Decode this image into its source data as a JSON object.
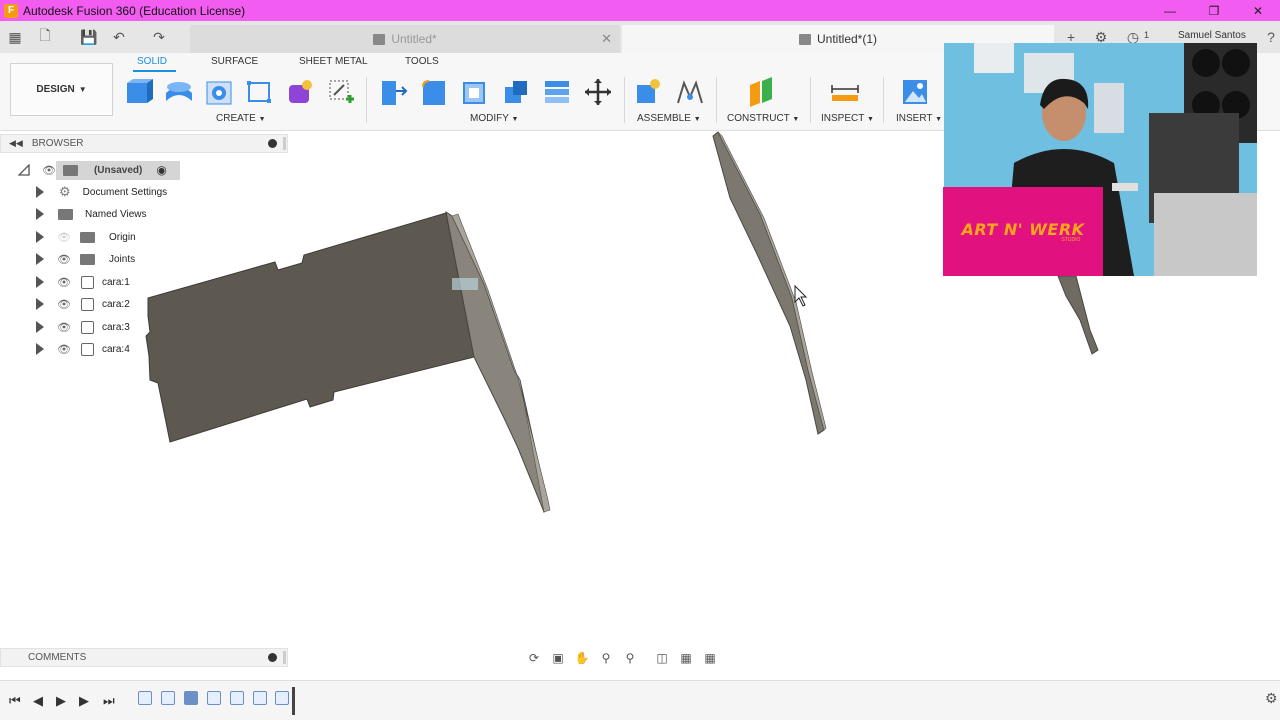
{
  "window": {
    "title": "Autodesk Fusion 360 (Education License)",
    "app_logo": "F"
  },
  "tabs": [
    {
      "label": "Untitled*",
      "active": false
    },
    {
      "label": "Untitled*(1)",
      "active": true
    }
  ],
  "user": {
    "name": "Samuel Santos"
  },
  "notifications_count": "1",
  "toolbar": {
    "workspace": "DESIGN",
    "workspace_tabs": [
      "SOLID",
      "SURFACE",
      "SHEET METAL",
      "TOOLS"
    ],
    "active_tab": "SOLID",
    "groups": [
      "CREATE",
      "MODIFY",
      "ASSEMBLE",
      "CONSTRUCT",
      "INSPECT",
      "INSERT"
    ]
  },
  "browser": {
    "title": "BROWSER",
    "root": "(Unsaved)",
    "items": [
      {
        "label": "Document Settings",
        "icon": "gear-icon"
      },
      {
        "label": "Named Views",
        "icon": "folder-icon"
      },
      {
        "label": "Origin",
        "icon": "folder-icon"
      },
      {
        "label": "Joints",
        "icon": "folder-icon"
      },
      {
        "label": "cara:1",
        "icon": "component-icon"
      },
      {
        "label": "cara:2",
        "icon": "component-icon"
      },
      {
        "label": "cara:3",
        "icon": "component-icon"
      },
      {
        "label": "cara:4",
        "icon": "component-icon"
      }
    ]
  },
  "comments": {
    "title": "COMMENTS"
  },
  "overlay": {
    "brand": "ART N' WERK",
    "brand_sub": "STUDIO"
  },
  "colors": {
    "titlebar": "#f25cf0",
    "accent": "#1a8fe0",
    "brand_bg": "#e1127f",
    "brand_text": "#f9a61a"
  }
}
